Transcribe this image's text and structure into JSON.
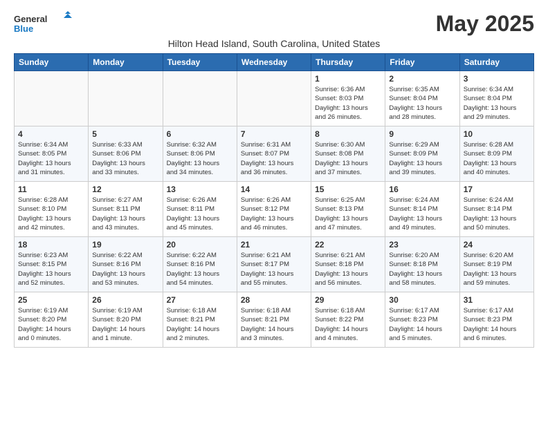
{
  "header": {
    "logo_line1": "General",
    "logo_line2": "Blue",
    "title": "May 2025",
    "subtitle": "Hilton Head Island, South Carolina, United States"
  },
  "weekdays": [
    "Sunday",
    "Monday",
    "Tuesday",
    "Wednesday",
    "Thursday",
    "Friday",
    "Saturday"
  ],
  "weeks": [
    [
      {
        "day": "",
        "info": ""
      },
      {
        "day": "",
        "info": ""
      },
      {
        "day": "",
        "info": ""
      },
      {
        "day": "",
        "info": ""
      },
      {
        "day": "1",
        "info": "Sunrise: 6:36 AM\nSunset: 8:03 PM\nDaylight: 13 hours\nand 26 minutes."
      },
      {
        "day": "2",
        "info": "Sunrise: 6:35 AM\nSunset: 8:04 PM\nDaylight: 13 hours\nand 28 minutes."
      },
      {
        "day": "3",
        "info": "Sunrise: 6:34 AM\nSunset: 8:04 PM\nDaylight: 13 hours\nand 29 minutes."
      }
    ],
    [
      {
        "day": "4",
        "info": "Sunrise: 6:34 AM\nSunset: 8:05 PM\nDaylight: 13 hours\nand 31 minutes."
      },
      {
        "day": "5",
        "info": "Sunrise: 6:33 AM\nSunset: 8:06 PM\nDaylight: 13 hours\nand 33 minutes."
      },
      {
        "day": "6",
        "info": "Sunrise: 6:32 AM\nSunset: 8:06 PM\nDaylight: 13 hours\nand 34 minutes."
      },
      {
        "day": "7",
        "info": "Sunrise: 6:31 AM\nSunset: 8:07 PM\nDaylight: 13 hours\nand 36 minutes."
      },
      {
        "day": "8",
        "info": "Sunrise: 6:30 AM\nSunset: 8:08 PM\nDaylight: 13 hours\nand 37 minutes."
      },
      {
        "day": "9",
        "info": "Sunrise: 6:29 AM\nSunset: 8:09 PM\nDaylight: 13 hours\nand 39 minutes."
      },
      {
        "day": "10",
        "info": "Sunrise: 6:28 AM\nSunset: 8:09 PM\nDaylight: 13 hours\nand 40 minutes."
      }
    ],
    [
      {
        "day": "11",
        "info": "Sunrise: 6:28 AM\nSunset: 8:10 PM\nDaylight: 13 hours\nand 42 minutes."
      },
      {
        "day": "12",
        "info": "Sunrise: 6:27 AM\nSunset: 8:11 PM\nDaylight: 13 hours\nand 43 minutes."
      },
      {
        "day": "13",
        "info": "Sunrise: 6:26 AM\nSunset: 8:11 PM\nDaylight: 13 hours\nand 45 minutes."
      },
      {
        "day": "14",
        "info": "Sunrise: 6:26 AM\nSunset: 8:12 PM\nDaylight: 13 hours\nand 46 minutes."
      },
      {
        "day": "15",
        "info": "Sunrise: 6:25 AM\nSunset: 8:13 PM\nDaylight: 13 hours\nand 47 minutes."
      },
      {
        "day": "16",
        "info": "Sunrise: 6:24 AM\nSunset: 8:14 PM\nDaylight: 13 hours\nand 49 minutes."
      },
      {
        "day": "17",
        "info": "Sunrise: 6:24 AM\nSunset: 8:14 PM\nDaylight: 13 hours\nand 50 minutes."
      }
    ],
    [
      {
        "day": "18",
        "info": "Sunrise: 6:23 AM\nSunset: 8:15 PM\nDaylight: 13 hours\nand 52 minutes."
      },
      {
        "day": "19",
        "info": "Sunrise: 6:22 AM\nSunset: 8:16 PM\nDaylight: 13 hours\nand 53 minutes."
      },
      {
        "day": "20",
        "info": "Sunrise: 6:22 AM\nSunset: 8:16 PM\nDaylight: 13 hours\nand 54 minutes."
      },
      {
        "day": "21",
        "info": "Sunrise: 6:21 AM\nSunset: 8:17 PM\nDaylight: 13 hours\nand 55 minutes."
      },
      {
        "day": "22",
        "info": "Sunrise: 6:21 AM\nSunset: 8:18 PM\nDaylight: 13 hours\nand 56 minutes."
      },
      {
        "day": "23",
        "info": "Sunrise: 6:20 AM\nSunset: 8:18 PM\nDaylight: 13 hours\nand 58 minutes."
      },
      {
        "day": "24",
        "info": "Sunrise: 6:20 AM\nSunset: 8:19 PM\nDaylight: 13 hours\nand 59 minutes."
      }
    ],
    [
      {
        "day": "25",
        "info": "Sunrise: 6:19 AM\nSunset: 8:20 PM\nDaylight: 14 hours\nand 0 minutes."
      },
      {
        "day": "26",
        "info": "Sunrise: 6:19 AM\nSunset: 8:20 PM\nDaylight: 14 hours\nand 1 minute."
      },
      {
        "day": "27",
        "info": "Sunrise: 6:18 AM\nSunset: 8:21 PM\nDaylight: 14 hours\nand 2 minutes."
      },
      {
        "day": "28",
        "info": "Sunrise: 6:18 AM\nSunset: 8:21 PM\nDaylight: 14 hours\nand 3 minutes."
      },
      {
        "day": "29",
        "info": "Sunrise: 6:18 AM\nSunset: 8:22 PM\nDaylight: 14 hours\nand 4 minutes."
      },
      {
        "day": "30",
        "info": "Sunrise: 6:17 AM\nSunset: 8:23 PM\nDaylight: 14 hours\nand 5 minutes."
      },
      {
        "day": "31",
        "info": "Sunrise: 6:17 AM\nSunset: 8:23 PM\nDaylight: 14 hours\nand 6 minutes."
      }
    ]
  ]
}
